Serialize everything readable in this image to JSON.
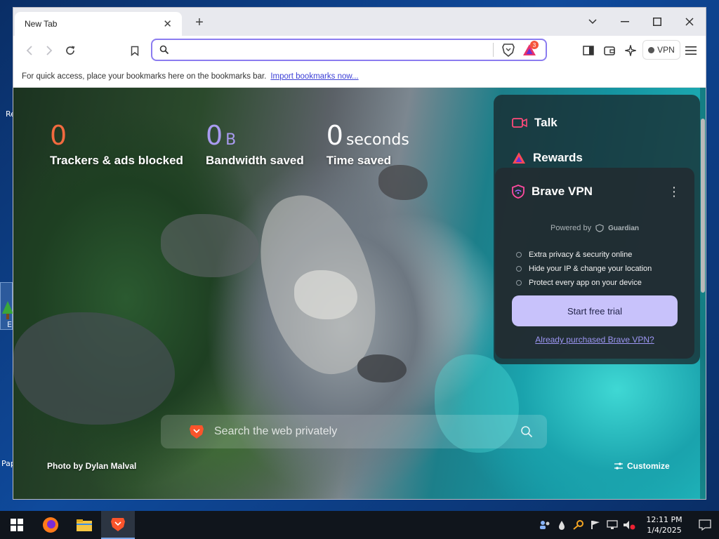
{
  "desktop": {
    "icon_fragments": [
      "Re",
      "E",
      "Pap"
    ]
  },
  "browser": {
    "tab": {
      "title": "New Tab"
    },
    "toolbar": {
      "address_value": "",
      "rewards_badge": "3",
      "vpn_label": "VPN"
    },
    "bookmarks_bar": {
      "text": "For quick access, place your bookmarks here on the bookmarks bar.",
      "link": "Import bookmarks now..."
    }
  },
  "new_tab_page": {
    "stats": [
      {
        "value": "0",
        "unit": "",
        "label": "Trackers & ads blocked",
        "color": "#f26a3f"
      },
      {
        "value": "0",
        "unit": "B",
        "label": "Bandwidth saved",
        "color": "#a99bf0"
      },
      {
        "value": "0",
        "unit": "seconds",
        "label": "Time saved",
        "color": "#ffffff"
      }
    ],
    "widgets": {
      "talk": "Talk",
      "rewards": "Rewards"
    },
    "vpn_card": {
      "title": "Brave VPN",
      "powered_by": "Powered by",
      "partner": "Guardian",
      "features": [
        "Extra privacy & security online",
        "Hide your IP & change your location",
        "Protect every app on your device"
      ],
      "cta": "Start free trial",
      "link": "Already purchased Brave VPN?"
    },
    "search_placeholder": "Search the web privately",
    "photo_credit": "Photo by Dylan Malval",
    "customize": "Customize"
  },
  "taskbar": {
    "time": "12:11 PM",
    "date": "1/4/2025"
  },
  "colors": {
    "accent": "#8b7cf0",
    "brave_orange": "#fb542b",
    "cta_bg": "#c8c2fb"
  }
}
